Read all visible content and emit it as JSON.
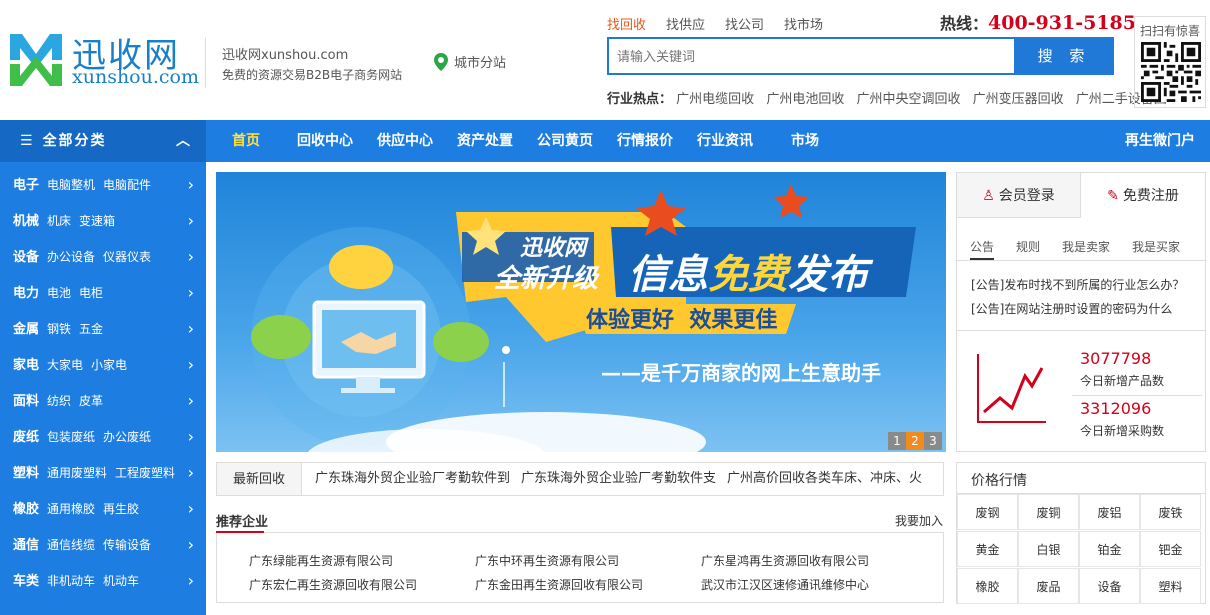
{
  "header": {
    "site_name": "迅收网xunshou.com",
    "slogan": "免费的资源交易B2B电子商务网站",
    "logo_text": "迅收网",
    "logo_domain": "xunshou.com",
    "city_station": "城市分站",
    "hotline_label": "热线：",
    "hotline_number": "400-931-5185",
    "qr_label": "扫扫有惊喜",
    "search": {
      "tabs": [
        "找回收",
        "找供应",
        "找公司",
        "找市场"
      ],
      "placeholder": "请输入关键词",
      "button": "搜 索"
    },
    "hot_label": "行业热点：",
    "hot_keywords": [
      "广州电缆回收",
      "广州电池回收",
      "广州中央空调回收",
      "广州变压器回收",
      "广州二手设备回"
    ]
  },
  "nav": {
    "all_categories": "全部分类",
    "items": [
      "首页",
      "回收中心",
      "供应中心",
      "资产处置",
      "公司黄页",
      "行情报价",
      "行业资讯",
      "市场"
    ],
    "right_item": "再生微门户"
  },
  "sidebar": [
    {
      "cat": "电子",
      "subs": [
        "电脑整机",
        "电脑配件"
      ]
    },
    {
      "cat": "机械",
      "subs": [
        "机床",
        "变速箱"
      ]
    },
    {
      "cat": "设备",
      "subs": [
        "办公设备",
        "仪器仪表"
      ]
    },
    {
      "cat": "电力",
      "subs": [
        "电池",
        "电柜"
      ]
    },
    {
      "cat": "金属",
      "subs": [
        "钢铁",
        "五金"
      ]
    },
    {
      "cat": "家电",
      "subs": [
        "大家电",
        "小家电"
      ]
    },
    {
      "cat": "面料",
      "subs": [
        "纺织",
        "皮革"
      ]
    },
    {
      "cat": "废纸",
      "subs": [
        "包装废纸",
        "办公废纸"
      ]
    },
    {
      "cat": "塑料",
      "subs": [
        "通用废塑料",
        "工程废塑料"
      ]
    },
    {
      "cat": "橡胶",
      "subs": [
        "通用橡胶",
        "再生胶"
      ]
    },
    {
      "cat": "通信",
      "subs": [
        "通信线缆",
        "传输设备"
      ]
    },
    {
      "cat": "车类",
      "subs": [
        "非机动车",
        "机动车"
      ]
    }
  ],
  "banner": {
    "badge_line1": "迅收网",
    "badge_line2": "全新升级",
    "headline_pre": "信息",
    "headline_highlight": "免费",
    "headline_post": "发布",
    "subline": "体验更好  效果更佳",
    "tagline": "——是千万商家的网上生意助手",
    "pager": [
      "1",
      "2",
      "3"
    ],
    "active_page": 1
  },
  "news": {
    "label": "最新回收",
    "items": [
      "广东珠海外贸企业验厂考勤软件到",
      "广东珠海外贸企业验厂考勤软件支",
      "广州高价回收各类车床、冲床、火"
    ]
  },
  "recommend": {
    "title": "推荐企业",
    "join": "我要加入",
    "companies": [
      "广东绿能再生资源有限公司",
      "广东中环再生资源有限公司",
      "广东星鸿再生资源回收有限公司",
      "广东宏仁再生资源回收有限公司",
      "广东金田再生资源回收有限公司",
      "武汉市江汉区速修通讯维修中心"
    ]
  },
  "member": {
    "login": "会员登录",
    "register": "免费注册",
    "tabs": [
      "公告",
      "规则",
      "我是卖家",
      "我是买家"
    ],
    "notices": [
      "[公告]发布时找不到所属的行业怎么办？",
      "[公告]在网站注册时设置的密码为什么"
    ],
    "stats": [
      {
        "value": "3077798",
        "label": "今日新增产品数"
      },
      {
        "value": "3312096",
        "label": "今日新增采购数"
      }
    ]
  },
  "price": {
    "title": "价格行情",
    "items": [
      "废钢",
      "废铜",
      "废铝",
      "废铁",
      "黄金",
      "白银",
      "铂金",
      "钯金",
      "橡胶",
      "废品",
      "设备",
      "塑料"
    ]
  },
  "colors": {
    "nav_blue": "#1e7de0",
    "accent_red": "#d4001a",
    "active_orange": "#e8581c",
    "nav_active": "#ffe33b"
  }
}
